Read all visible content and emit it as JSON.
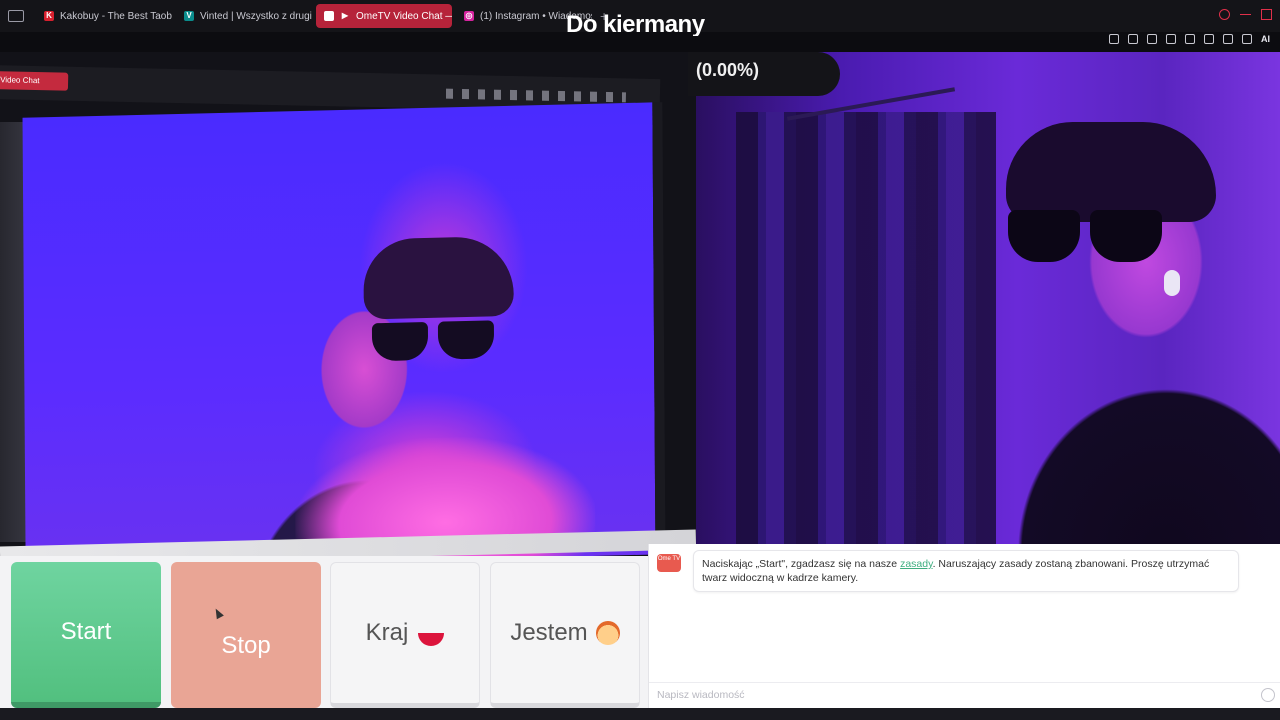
{
  "browser": {
    "tabs": [
      {
        "label": "Kakobuy - The Best Taob",
        "favicon": "K",
        "color": "#d8202e",
        "active": false
      },
      {
        "label": "Vinted | Wszystko z drugi",
        "favicon": "V",
        "color": "#0a8c8c",
        "active": false
      },
      {
        "label": "OmeTV Video Chat —",
        "favicon": "▶",
        "color": "#ffffff",
        "active": true
      },
      {
        "label": "(1) Instagram • Wiadomośc",
        "favicon": "◎",
        "color": "#d6249f",
        "active": false
      }
    ],
    "toolbar_ai_label": "AI"
  },
  "overlay": {
    "title": "Do kiermany",
    "percent": "(0.00%)"
  },
  "left_video": {
    "shot_tab_label": "Video Chat"
  },
  "controls": {
    "start_label": "Start",
    "stop_label": "Stop",
    "country_label": "Kraj",
    "gender_label": "Jestem"
  },
  "chat": {
    "logo_text": "Ome TV",
    "message_before": "Naciskając „Start\", zgadzasz się na nasze ",
    "message_link": "zasady",
    "message_after": ". Naruszający zasady zostaną zbanowani. Proszę utrzymać twarz widoczną w kadrze kamery.",
    "input_placeholder": "Napisz wiadomość"
  },
  "colors": {
    "start": "#5ccb8b",
    "stop": "#e9a595",
    "accent_link": "#3fae80",
    "active_tab": "#b6233a"
  }
}
